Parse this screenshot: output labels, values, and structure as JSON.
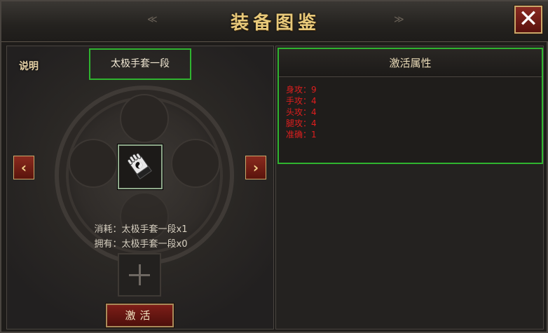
{
  "window": {
    "title": "装备图鉴",
    "close_label": "✕"
  },
  "left": {
    "explain_label": "说明",
    "item_name": "太极手套一段",
    "prev_arrow": "‹",
    "next_arrow": "›",
    "consume_text": "消耗：太极手套一段x1",
    "own_text": "拥有：太极手套一段x0",
    "activate_label": "激活"
  },
  "right": {
    "header": "激活属性",
    "attributes": [
      "身攻：9",
      "手攻：4",
      "头攻：4",
      "腿攻：4",
      "准确：1"
    ]
  },
  "colors": {
    "title_gold": "#e8c97a",
    "highlight_green": "#2fb42f",
    "attribute_red": "#e01e1e",
    "button_red": "#7e1e18"
  }
}
